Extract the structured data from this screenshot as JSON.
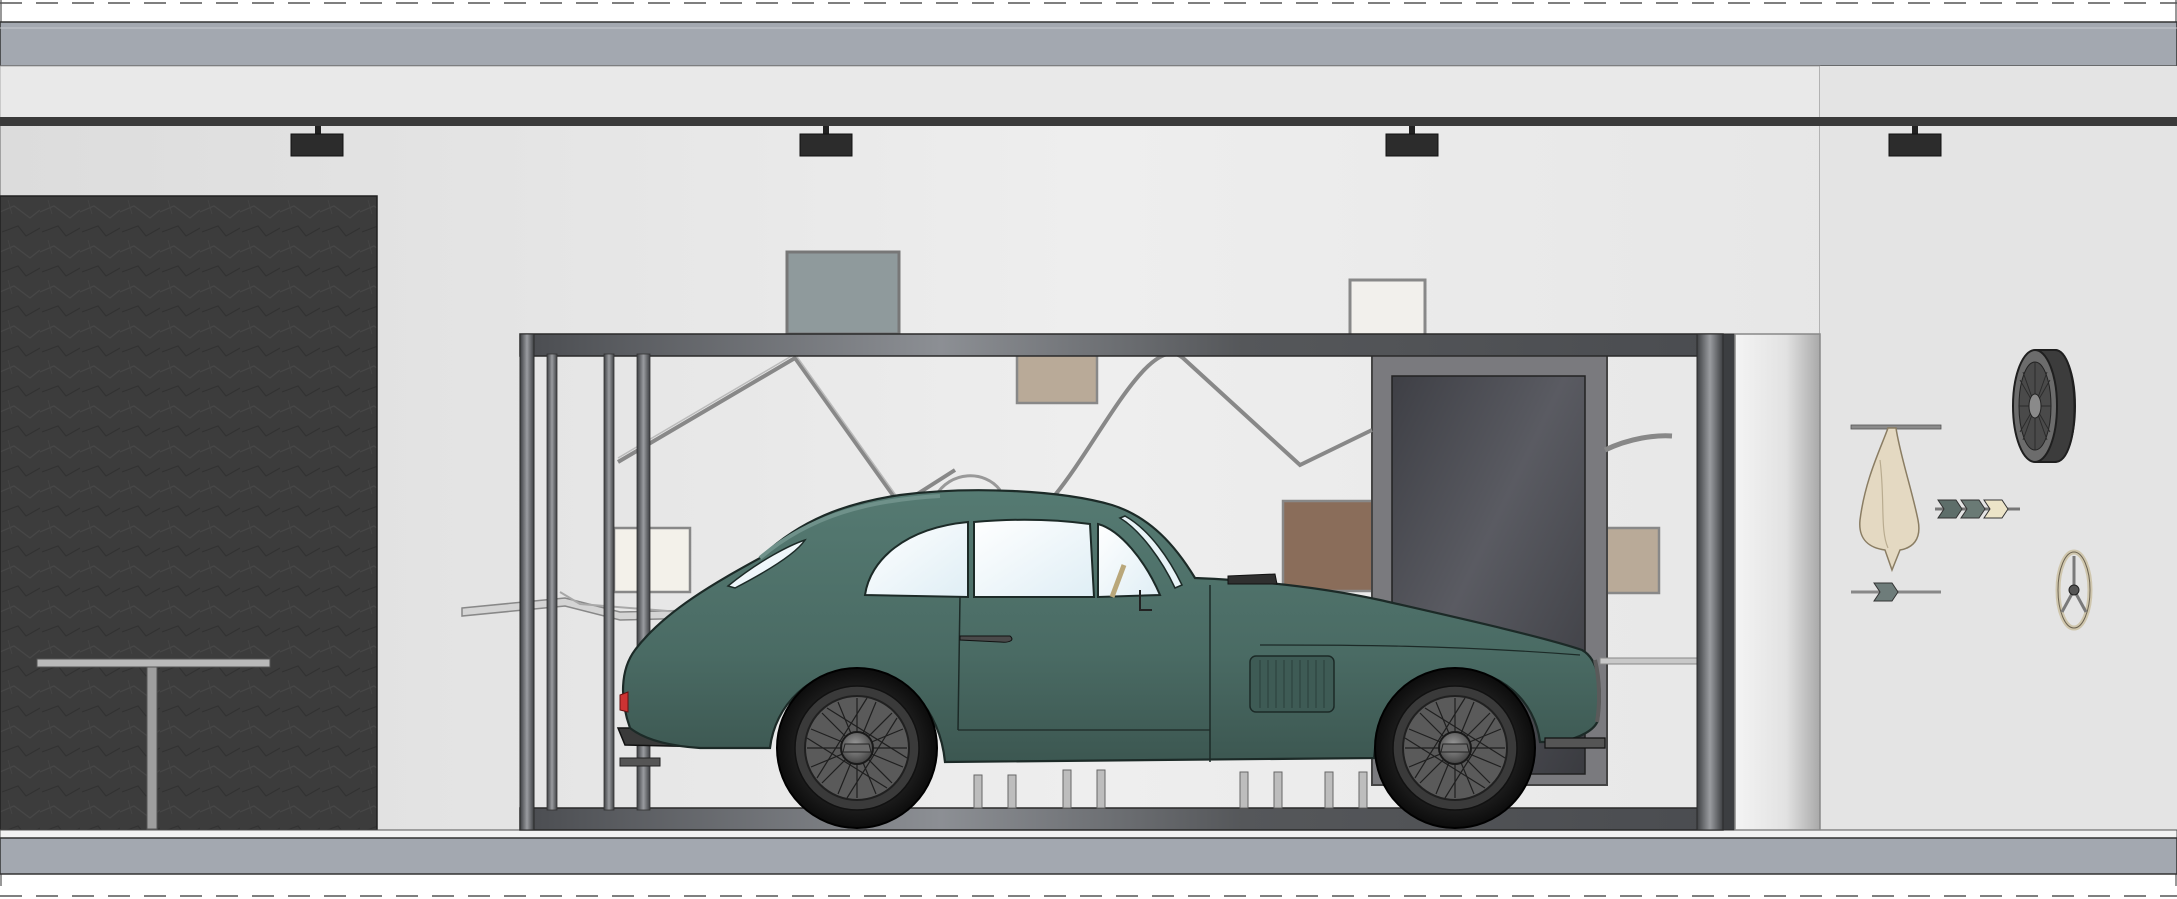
{
  "scene": {
    "title": "",
    "colors": {
      "background": "#ffffff",
      "wall": "#e6e6e6",
      "ceiling_band": "#a3a8b0",
      "slate_panel": "#3f3f3f",
      "car_body": "#4a6b64",
      "frame_metal": "#55575a",
      "track_rail": "#3a3a3a",
      "door_glass": "#4a4b52"
    },
    "elements": {
      "ceiling_band": "ceiling-band",
      "floor_band": "floor-band",
      "track_lights": 4,
      "display_frame": "display-frame",
      "classic_car": "classic-car",
      "slate_panel": "slate-panel",
      "side_table": "side-table",
      "wall_hung_wheel": "wire-wheel-rim",
      "steering_wheel": "steering-wheel",
      "hanging_cloth": "hanging-cloth",
      "arrow_hooks": "arrow-hooks"
    }
  }
}
